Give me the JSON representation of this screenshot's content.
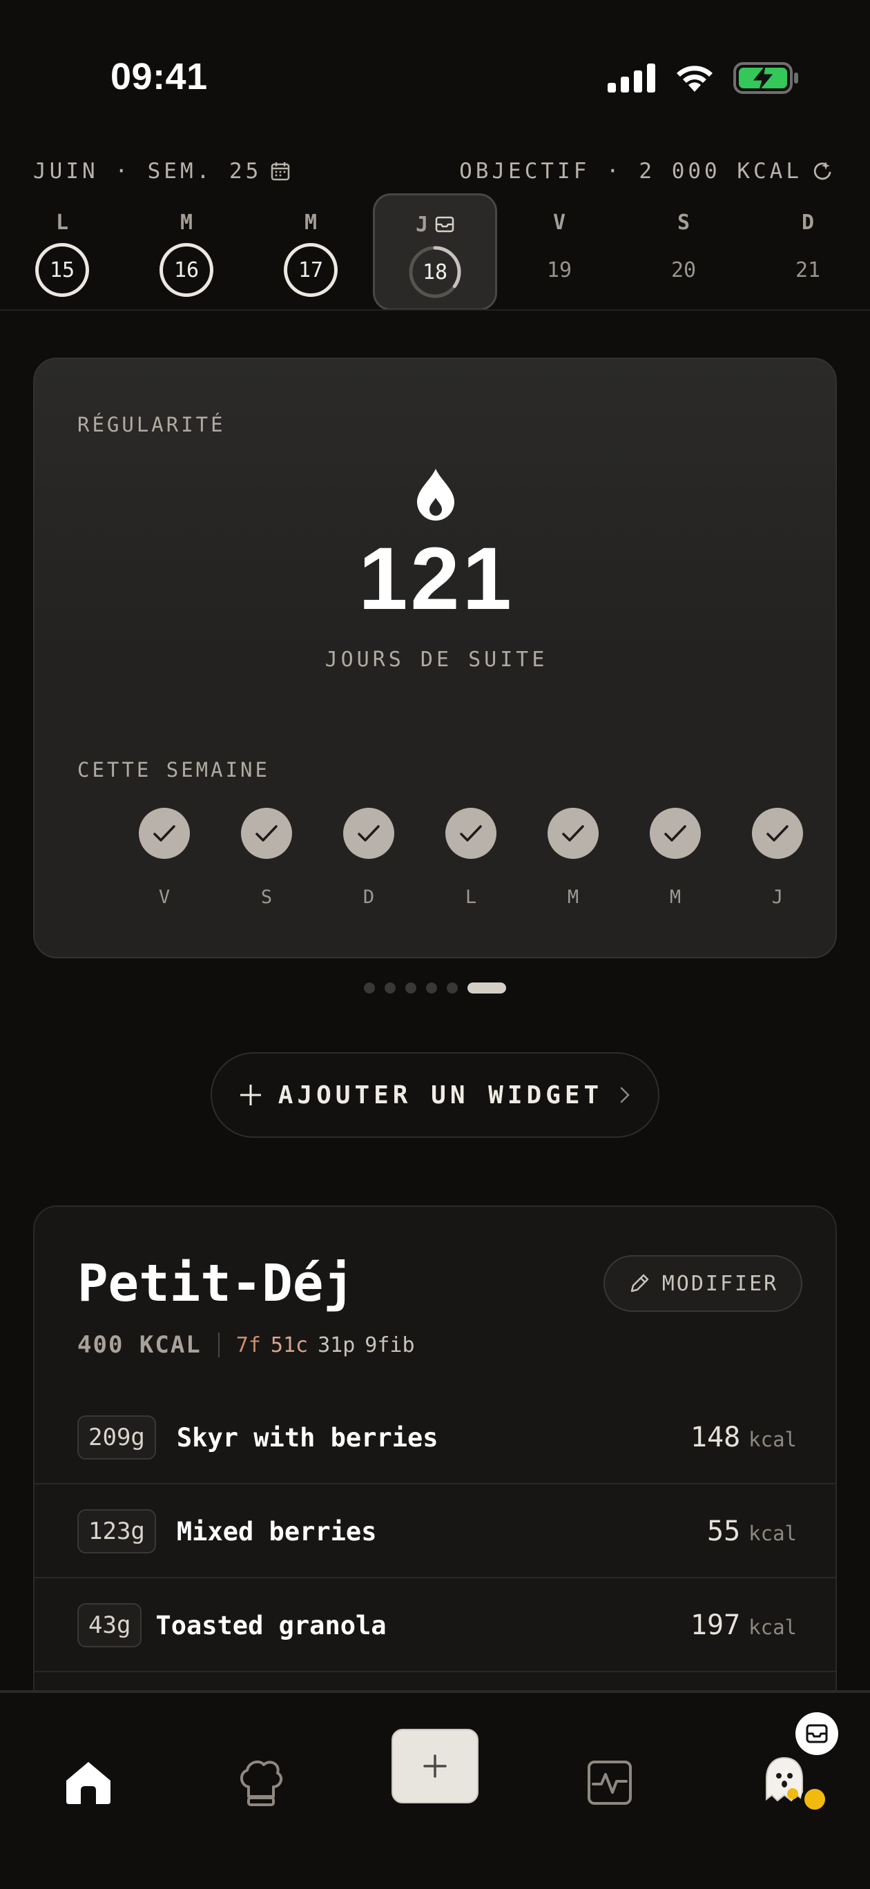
{
  "status_bar": {
    "time": "09:41"
  },
  "week_header": {
    "week_label": "JUIN · SEM. 25",
    "goal_label": "OBJECTIF · 2 000 KCAL",
    "days": [
      {
        "letter": "L",
        "number": "15",
        "state": "done"
      },
      {
        "letter": "M",
        "number": "16",
        "state": "done"
      },
      {
        "letter": "M",
        "number": "17",
        "state": "done"
      },
      {
        "letter": "J",
        "number": "18",
        "state": "today",
        "progress": 0.35
      },
      {
        "letter": "V",
        "number": "19",
        "state": "future"
      },
      {
        "letter": "S",
        "number": "20",
        "state": "future"
      },
      {
        "letter": "D",
        "number": "21",
        "state": "future"
      }
    ]
  },
  "streak_card": {
    "title": "RÉGULARITÉ",
    "streak_value": "121",
    "streak_caption": "JOURS DE SUITE",
    "week_title": "CETTE SEMAINE",
    "week_days": [
      "V",
      "S",
      "D",
      "L",
      "M",
      "M",
      "J"
    ]
  },
  "pager": {
    "count": 6,
    "active_index": 5
  },
  "add_widget": {
    "label": "AJOUTER UN WIDGET"
  },
  "meal": {
    "title": "Petit-Déj",
    "edit_label": "MODIFIER",
    "kcal_total": "400 KCAL",
    "macros": {
      "fat": "7f",
      "carbs": "51c",
      "protein": "31p",
      "fiber": "9fib"
    },
    "items": [
      {
        "qty": "209g",
        "name": "Skyr with berries",
        "kcal": "148",
        "unit": "kcal"
      },
      {
        "qty": "123g",
        "name": "Mixed berries",
        "kcal": "55",
        "unit": "kcal"
      },
      {
        "qty": "43g",
        "name": "Toasted granola",
        "kcal": "197",
        "unit": "kcal"
      }
    ]
  },
  "bottom_nav": {
    "items": [
      "home-icon",
      "chef-hat-icon",
      "add-icon",
      "activity-icon",
      "ghost-avatar"
    ]
  },
  "colors": {
    "background": "#0e0d0c",
    "card": "#232221",
    "check": "#b9b2aa",
    "macro_fat": "#d08c6e",
    "macro_carb": "#d9a58e",
    "battery_green": "#34c759",
    "status_dot": "#f2b90f"
  }
}
